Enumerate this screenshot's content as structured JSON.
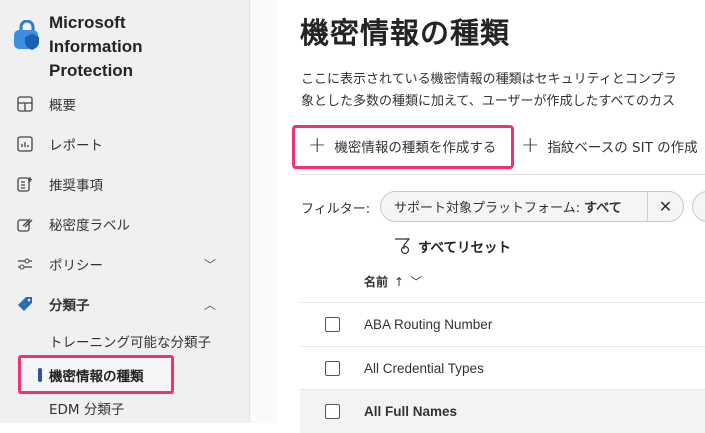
{
  "app": {
    "title_lines": [
      "Microsoft",
      "Information",
      "Protection"
    ]
  },
  "sidebar": {
    "items": [
      {
        "label": "概要",
        "icon": "dashboard-icon"
      },
      {
        "label": "レポート",
        "icon": "report-icon"
      },
      {
        "label": "推奨事項",
        "icon": "recommendations-icon"
      },
      {
        "label": "秘密度ラベル",
        "icon": "label-icon"
      },
      {
        "label": "ポリシー",
        "icon": "policy-icon",
        "chevron": "down"
      },
      {
        "label": "分類子",
        "icon": "tag-icon",
        "chevron": "up"
      }
    ],
    "subitems": [
      {
        "label": "トレーニング可能な分類子"
      },
      {
        "label": "機密情報の種類",
        "selected": true
      },
      {
        "label": "EDM 分類子"
      }
    ]
  },
  "main": {
    "title": "機密情報の種類",
    "description_lines": [
      "ここに表示されている機密情報の種類はセキュリティとコンプラ",
      "象とした多数の種類に加えて、ユーザーが作成したすべてのカス"
    ],
    "commands": {
      "create": "機密情報の種類を作成する",
      "fingerprint": "指紋ベースの SIT の作成"
    },
    "filter": {
      "label": "フィルター:",
      "pill_key": "サポート対象プラットフォーム:",
      "pill_value": "すべて",
      "reset": "すべてリセット"
    },
    "table": {
      "column": "名前",
      "sort": "↑",
      "rows": [
        "ABA Routing Number",
        "All Credential Types",
        "All Full Names"
      ]
    }
  },
  "colors": {
    "highlight": "#f0346b",
    "accent": "#2b5797"
  }
}
